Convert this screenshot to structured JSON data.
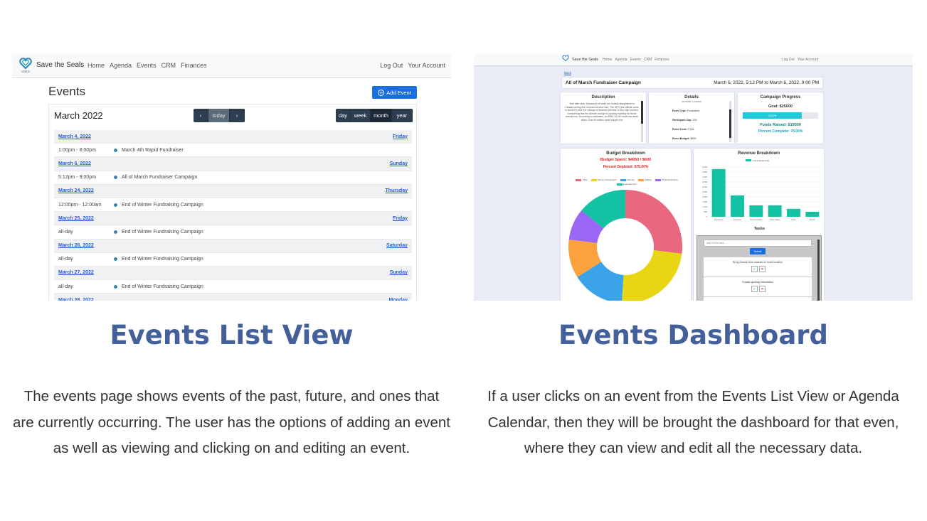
{
  "left": {
    "nav": {
      "logo_text": "CREO",
      "brand": "Save the Seals",
      "links": [
        "Home",
        "Agenda",
        "Events",
        "CRM",
        "Finances"
      ],
      "right_links": [
        "Log Out",
        "Your Account"
      ]
    },
    "page_title": "Events",
    "add_event_label": "Add Event",
    "calendar": {
      "month": "March 2022",
      "nav_buttons": [
        "‹",
        "today",
        "›"
      ],
      "view_buttons": [
        "day",
        "week",
        "month",
        "year"
      ],
      "active_view": "month",
      "rows": [
        {
          "kind": "day",
          "date": "March 4, 2022",
          "weekday": "Friday"
        },
        {
          "kind": "event",
          "time": "1:00pm - 8:00pm",
          "name": "March 4th Rapid Fundraiser"
        },
        {
          "kind": "day",
          "date": "March 6, 2022",
          "weekday": "Sunday"
        },
        {
          "kind": "event",
          "time": "5:12pm - 9:00pm",
          "name": "All of March Fundraiser Campaign"
        },
        {
          "kind": "day",
          "date": "March 24, 2022",
          "weekday": "Thursday"
        },
        {
          "kind": "event",
          "time": "12:00pm - 12:00am",
          "name": "End of Winter Fundraising Campaign"
        },
        {
          "kind": "day",
          "date": "March 25, 2022",
          "weekday": "Friday"
        },
        {
          "kind": "event",
          "time": "all-day",
          "name": "End of Winter Fundraising Campaign"
        },
        {
          "kind": "day",
          "date": "March 26, 2022",
          "weekday": "Saturday"
        },
        {
          "kind": "event",
          "time": "all-day",
          "name": "End of Winter Fundraising Campaign"
        },
        {
          "kind": "day",
          "date": "March 27, 2022",
          "weekday": "Sunday"
        },
        {
          "kind": "event",
          "time": "all-day",
          "name": "End of Winter Fundraising Campaign"
        },
        {
          "kind": "day",
          "date": "March 28, 2022",
          "weekday": "Monday"
        }
      ]
    }
  },
  "right": {
    "nav": {
      "brand": "Save the Seals",
      "links": [
        "Home",
        "Agenda",
        "Events",
        "CRM",
        "Finances"
      ],
      "right_links": [
        "Log Out",
        "Your Account"
      ]
    },
    "back_link": "Back",
    "campaign": {
      "name": "All of March Fundraiser Campaign",
      "dates": "March 6, 2022, 5:12 PM to March 6, 2022, 9:00 PM"
    },
    "description": {
      "title": "Description",
      "text": "Year after year, thousands of seals are brutally slaughtered in Canada during the commercial seal hunt. The DFO (the official name is NIGHTS) and the ministry of fisheries will take a very high number, considering that the climate change is causing mortality for those animals too. According to estimates, an 8364 34,000 seals has been killed. Over 50 million have happen the"
    },
    "details": {
      "title": "Details",
      "subtitle": "LEONIDE VLASMAN",
      "rows": [
        {
          "label": "Event Type:",
          "value": "Fundraiser"
        },
        {
          "label": "Participant Cap:",
          "value": "100"
        },
        {
          "label": "Event Code:",
          "value": "F12A"
        },
        {
          "label": "Event Budget:",
          "value": "$600"
        }
      ]
    },
    "progress": {
      "title": "Campaign Progress",
      "goal": "Goal: $25000",
      "bar_label": "78.00%",
      "fraction": 0.78,
      "funds": "Funds Raised: $19500",
      "percent": "Percent Complete: 78.00%"
    },
    "budget": {
      "title": "Budget Breakdown",
      "spent": "Budget Spent: $4050 / $600",
      "depleted": "Percent Depleted: 675.00%"
    },
    "revenue": {
      "title": "Revenue Breakdown"
    },
    "tasks": {
      "title": "Tasks",
      "placeholder": "Add a new task",
      "submit_label": "Submit",
      "items": [
        "Bring Donuts from walmart to event location",
        "Explain guiding information"
      ],
      "check_glyph": "✓",
      "x_glyph": "✕"
    }
  },
  "chart_data": [
    {
      "type": "pie",
      "title": "Budget Breakdown",
      "donut": true,
      "categories": [
        "Other",
        "Venue & Equipment",
        "Catering",
        "Staffing",
        "PR & Advertising",
        "Entertainment"
      ],
      "values": [
        27,
        24,
        15,
        11,
        9,
        14
      ],
      "colors": [
        "#e9667f",
        "#e8d614",
        "#3ba3e8",
        "#fba13e",
        "#9a66f5",
        "#12c2a3"
      ]
    },
    {
      "type": "bar",
      "title": "Revenue Breakdown",
      "series": [
        {
          "name": "Funds Raised ($)",
          "values": [
            4800,
            2150,
            1150,
            1150,
            800,
            500
          ]
        }
      ],
      "categories": [
        "Donations",
        "Auctions",
        "Sponsorships",
        "Ticket Sales",
        "Other",
        "Merch"
      ],
      "ylim": [
        0,
        5000
      ],
      "ticks": [
        "0",
        "500",
        "1,000",
        "1,500",
        "2,000",
        "2,500",
        "3,000",
        "3,500",
        "4,000",
        "4,500",
        "5,000"
      ],
      "grid": true,
      "legend": "top",
      "color": "#12c2a3"
    }
  ],
  "captions": {
    "left_heading": "Events List View",
    "left_text": "The events page shows events of the past, future, and ones that are currently occurring. The user has the options of adding an event as well as viewing and clicking on and editing an event.",
    "right_heading": "Events Dashboard",
    "right_text": "If a user clicks on an event from the Events List View or Agenda Calendar, then they will be brought the dashboard for that even, where they can view and edit all the necessary data."
  }
}
